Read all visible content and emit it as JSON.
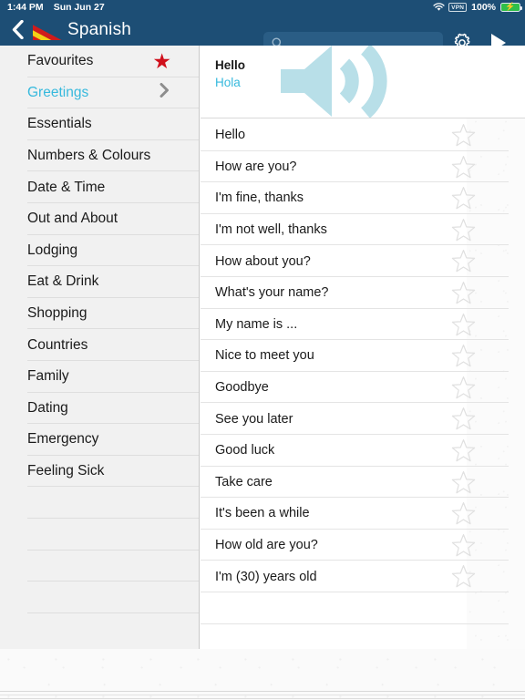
{
  "status_bar": {
    "time": "1:44 PM",
    "date": "Sun Jun 27",
    "vpn_label": "VPN",
    "battery_percent": "100%",
    "wifi_icon": "wifi-icon",
    "battery_icon": "battery-charging-icon"
  },
  "nav": {
    "back_icon": "chevron-left-icon",
    "flag_icon": "spanish-flag-icon",
    "title": "Spanish",
    "search_value": "",
    "search_placeholder": "",
    "search_icon": "search-icon",
    "settings_icon": "gear-icon",
    "play_icon": "play-icon"
  },
  "sidebar": {
    "items": [
      {
        "label": "Favourites",
        "accessory": "star",
        "selected": false
      },
      {
        "label": "Greetings",
        "accessory": "chevron",
        "selected": true
      },
      {
        "label": "Essentials",
        "accessory": "none",
        "selected": false
      },
      {
        "label": "Numbers & Colours",
        "accessory": "none",
        "selected": false
      },
      {
        "label": "Date & Time",
        "accessory": "none",
        "selected": false
      },
      {
        "label": "Out and About",
        "accessory": "none",
        "selected": false
      },
      {
        "label": "Lodging",
        "accessory": "none",
        "selected": false
      },
      {
        "label": "Eat & Drink",
        "accessory": "none",
        "selected": false
      },
      {
        "label": "Shopping",
        "accessory": "none",
        "selected": false
      },
      {
        "label": "Countries",
        "accessory": "none",
        "selected": false
      },
      {
        "label": "Family",
        "accessory": "none",
        "selected": false
      },
      {
        "label": "Dating",
        "accessory": "none",
        "selected": false
      },
      {
        "label": "Emergency",
        "accessory": "none",
        "selected": false
      },
      {
        "label": "Feeling Sick",
        "accessory": "none",
        "selected": false
      },
      {
        "label": "",
        "accessory": "none",
        "selected": false
      },
      {
        "label": "",
        "accessory": "none",
        "selected": false
      },
      {
        "label": "",
        "accessory": "none",
        "selected": false
      },
      {
        "label": "",
        "accessory": "none",
        "selected": false
      }
    ]
  },
  "phrase_header": {
    "source_text": "Hello",
    "translation_text": "Hola",
    "speaker_icon": "speaker-volume-icon"
  },
  "phrase_list": {
    "star_icon": "star-outline-icon",
    "rows": [
      {
        "text": "Hello",
        "starred": false
      },
      {
        "text": "How are you?",
        "starred": false
      },
      {
        "text": "I'm fine, thanks",
        "starred": false
      },
      {
        "text": "I'm not well, thanks",
        "starred": false
      },
      {
        "text": "How about you?",
        "starred": false
      },
      {
        "text": "What's your name?",
        "starred": false
      },
      {
        "text": "My name is ...",
        "starred": false
      },
      {
        "text": "Nice to meet you",
        "starred": false
      },
      {
        "text": "Goodbye",
        "starred": false
      },
      {
        "text": "See you later",
        "starred": false
      },
      {
        "text": "Good luck",
        "starred": false
      },
      {
        "text": "Take care",
        "starred": false
      },
      {
        "text": "It's been a while",
        "starred": false
      },
      {
        "text": "How old are you?",
        "starred": false
      },
      {
        "text": "I'm (30) years old",
        "starred": false
      }
    ]
  },
  "colors": {
    "navbar": "#1d4e75",
    "accent_cyan": "#36b9dd",
    "favourite_red": "#d0101c",
    "speaker_blue": "#b8dfe8",
    "sidebar_bg": "#f1f1f1"
  }
}
